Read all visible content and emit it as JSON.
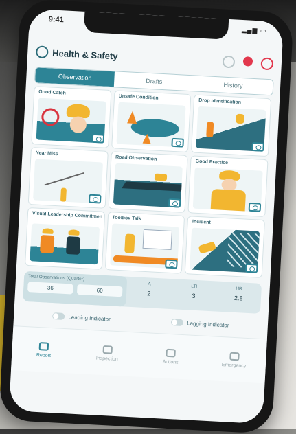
{
  "status_bar": {
    "time": "9:41"
  },
  "header": {
    "title": "Health & Safety"
  },
  "tabs": [
    {
      "label": "Observation",
      "active": true
    },
    {
      "label": "Drafts",
      "active": false
    },
    {
      "label": "History",
      "active": false
    }
  ],
  "cards": [
    {
      "label": "Good Catch"
    },
    {
      "label": "Unsafe Condition"
    },
    {
      "label": "Drop Identification"
    },
    {
      "label": "Near Miss"
    },
    {
      "label": "Road Observation"
    },
    {
      "label": "Good Practice"
    },
    {
      "label": "Visual Leadership Commitment"
    },
    {
      "label": "Toolbox Talk"
    },
    {
      "label": "Incident"
    }
  ],
  "stats": {
    "header": "Total Observations (Quarter)",
    "left_values": [
      "36",
      "60"
    ],
    "columns": [
      {
        "label": "A",
        "value": "2"
      },
      {
        "label": "LTI",
        "value": "3"
      },
      {
        "label": "HR",
        "value": "2.8"
      }
    ]
  },
  "toggles": [
    {
      "label": "Leading Indicator"
    },
    {
      "label": "Lagging Indicator"
    }
  ],
  "bottom_nav": [
    {
      "label": "Report",
      "active": true
    },
    {
      "label": "Inspection",
      "active": false
    },
    {
      "label": "Actions",
      "active": false
    },
    {
      "label": "Emergency",
      "active": false
    }
  ],
  "colors": {
    "accent": "#2d8496",
    "background": "#f4f7f8",
    "bg_yellow": "#d7b52a"
  }
}
